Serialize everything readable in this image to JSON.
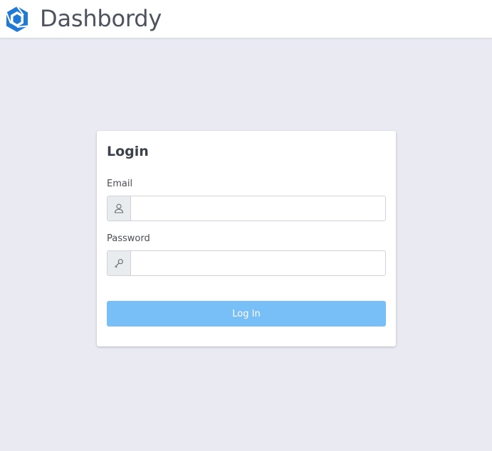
{
  "header": {
    "brand_name": "Dashbordy",
    "logo_icon": "hexagon-logo-icon",
    "brand_color": "#1e7ad6"
  },
  "login_form": {
    "title": "Login",
    "email": {
      "label": "Email",
      "value": "",
      "placeholder": "",
      "icon": "user-icon"
    },
    "password": {
      "label": "Password",
      "value": "",
      "placeholder": "",
      "icon": "key-icon"
    },
    "submit_label": "Log In",
    "submit_color": "#78bff8"
  },
  "colors": {
    "page_background": "#e9eaf2",
    "card_background": "#ffffff"
  }
}
